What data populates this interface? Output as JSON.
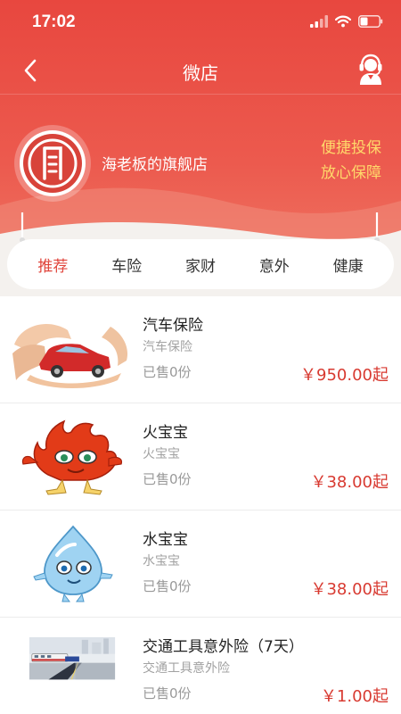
{
  "status_bar": {
    "time": "17:02"
  },
  "nav": {
    "title": "微店"
  },
  "shop": {
    "name": "海老板的旗舰店",
    "slogan_line1": "便捷投保",
    "slogan_line2": "放心保障"
  },
  "tabs": [
    {
      "label": "推荐",
      "active": true
    },
    {
      "label": "车险",
      "active": false
    },
    {
      "label": "家财",
      "active": false
    },
    {
      "label": "意外",
      "active": false
    },
    {
      "label": "健康",
      "active": false
    }
  ],
  "products": [
    {
      "title": "汽车保险",
      "subtitle": "汽车保险",
      "sold": "已售0份",
      "price": "￥950.00起",
      "image": "car-insurance-image"
    },
    {
      "title": "火宝宝",
      "subtitle": "火宝宝",
      "sold": "已售0份",
      "price": "￥38.00起",
      "image": "fire-mascot-image"
    },
    {
      "title": "水宝宝",
      "subtitle": "水宝宝",
      "sold": "已售0份",
      "price": "￥38.00起",
      "image": "water-mascot-image"
    },
    {
      "title": "交通工具意外险（7天）",
      "subtitle": "交通工具意外险",
      "sold": "已售0份",
      "price": "￥1.00起",
      "image": "traffic-station-image"
    }
  ],
  "colors": {
    "brand_red": "#e8473f",
    "slogan_yellow": "#ffd86a",
    "price_red": "#d83a31",
    "active_tab": "#e0453c"
  }
}
